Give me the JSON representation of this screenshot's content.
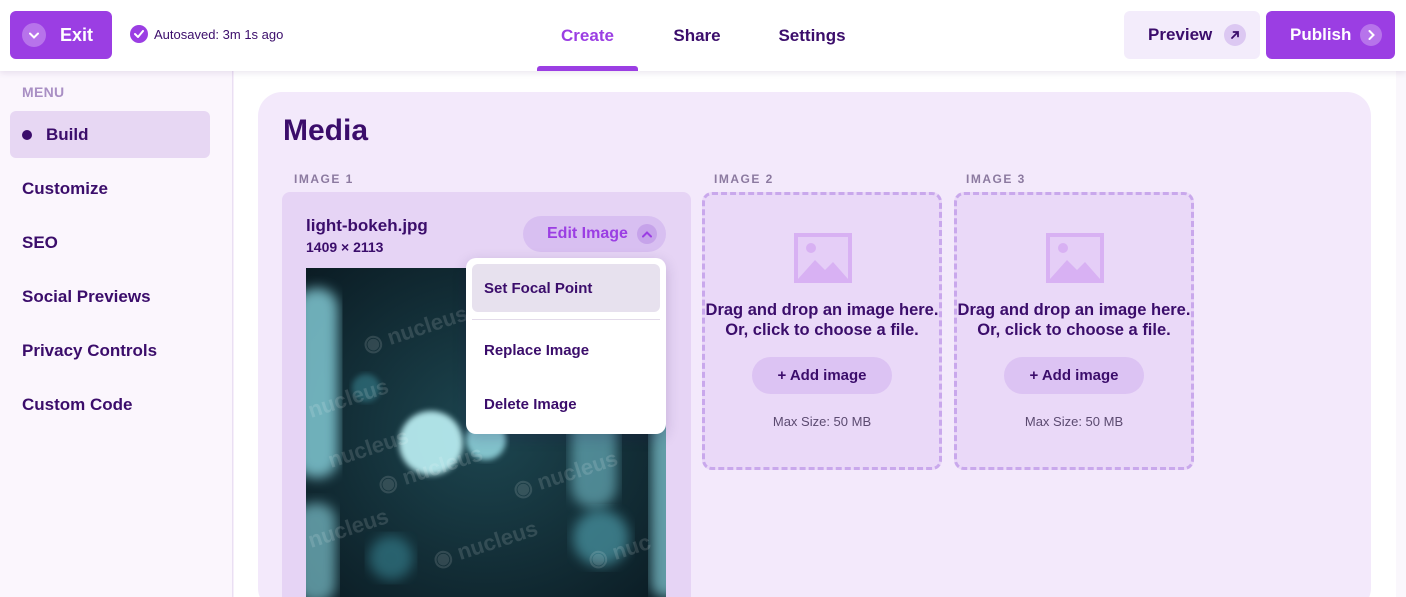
{
  "topbar": {
    "exit_label": "Exit",
    "autosave_text": "Autosaved: 3m 1s ago",
    "tabs": [
      {
        "label": "Create",
        "active": true
      },
      {
        "label": "Share",
        "active": false
      },
      {
        "label": "Settings",
        "active": false
      }
    ],
    "preview_label": "Preview",
    "publish_label": "Publish"
  },
  "sidebar": {
    "menu_label": "MENU",
    "items": [
      {
        "label": "Build",
        "active": true
      },
      {
        "label": "Customize",
        "active": false
      },
      {
        "label": "SEO",
        "active": false
      },
      {
        "label": "Social Previews",
        "active": false
      },
      {
        "label": "Privacy Controls",
        "active": false
      },
      {
        "label": "Custom Code",
        "active": false
      }
    ]
  },
  "main": {
    "title": "Media",
    "images": [
      {
        "label": "IMAGE 1",
        "filename": "light-bokeh.jpg",
        "dimensions": "1409 × 2113",
        "edit_label": "Edit Image",
        "watermark": "nucleus",
        "menu": [
          "Set Focal Point",
          "Replace Image",
          "Delete Image"
        ]
      },
      {
        "label": "IMAGE 2",
        "drop_line1": "Drag and drop an image here.",
        "drop_line2": "Or, click to choose a file.",
        "add_label": "+ Add image",
        "max_size": "Max Size: 50 MB"
      },
      {
        "label": "IMAGE 3",
        "drop_line1": "Drag and drop an image here.",
        "drop_line2": "Or, click to choose a file.",
        "add_label": "+ Add image",
        "max_size": "Max Size: 50 MB"
      }
    ]
  },
  "colors": {
    "accent": "#9b3ee3",
    "text": "#3b0d6b",
    "panel": "#f3e9fb",
    "active_nav": "#e7d7f3"
  },
  "icons": [
    "chevron-down-icon",
    "check-circle-icon",
    "arrow-up-right-icon",
    "chevron-right-icon",
    "chevron-up-icon",
    "image-placeholder-icon"
  ]
}
